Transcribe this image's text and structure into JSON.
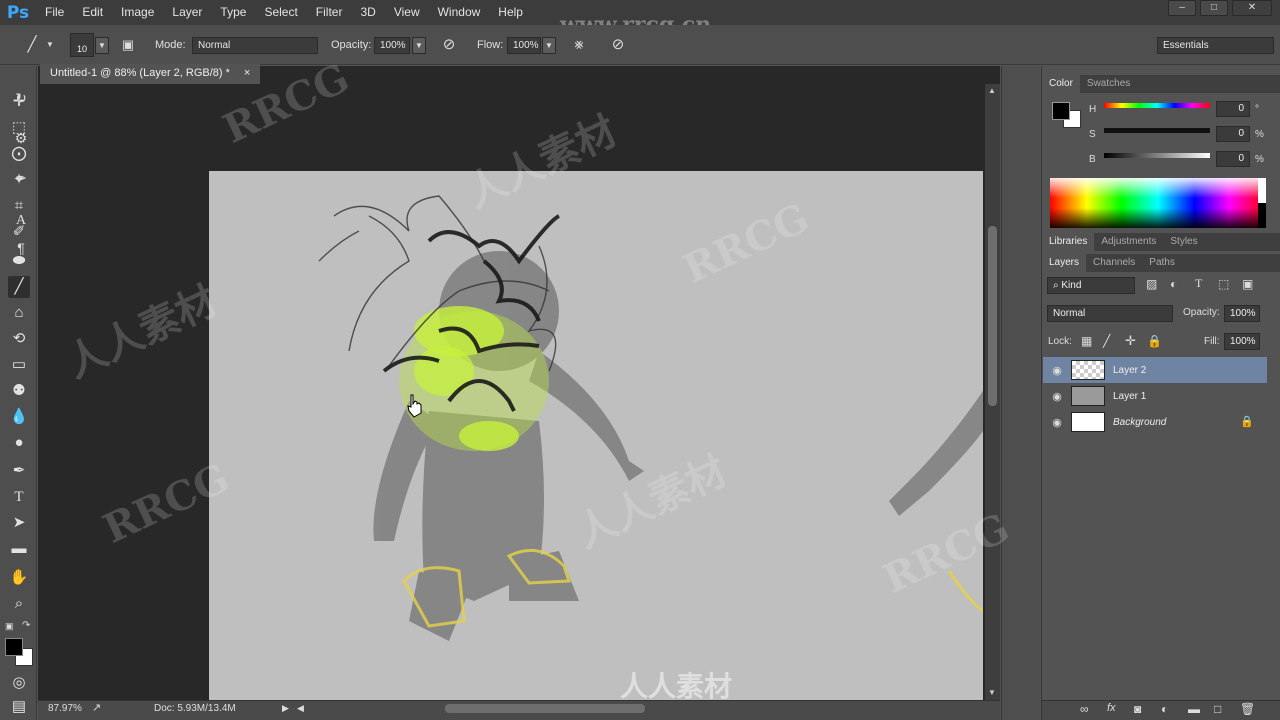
{
  "app": {
    "logo": "Ps",
    "menu": [
      "File",
      "Edit",
      "Image",
      "Layer",
      "Type",
      "Select",
      "Filter",
      "3D",
      "View",
      "Window",
      "Help"
    ],
    "window_controls": [
      "–",
      "□",
      "✕"
    ],
    "watermark_url": "www.rrcg.cn"
  },
  "options_bar": {
    "brush_size": "10",
    "mode_label": "Mode:",
    "mode_value": "Normal",
    "opacity_label": "Opacity:",
    "opacity_value": "100%",
    "flow_label": "Flow:",
    "flow_value": "100%",
    "workspace": "Essentials"
  },
  "document": {
    "tab_title": "Untitled-1 @ 88% (Layer 2, RGB/8) *",
    "tab_close": "×",
    "zoom": "87.97%",
    "doc_info": "Doc: 5.93M/13.4M"
  },
  "color_panel": {
    "tabs": [
      "Color",
      "Swatches"
    ],
    "sliders": [
      {
        "label": "H",
        "value": "0",
        "unit": "°"
      },
      {
        "label": "S",
        "value": "0",
        "unit": "%"
      },
      {
        "label": "B",
        "value": "0",
        "unit": "%"
      }
    ],
    "foreground": "#000000",
    "background": "#ffffff"
  },
  "libraries_panel": {
    "tabs": [
      "Libraries",
      "Adjustments",
      "Styles"
    ]
  },
  "layers_panel": {
    "tabs": [
      "Layers",
      "Channels",
      "Paths"
    ],
    "filter_kind": "⌕ Kind",
    "blend_mode": "Normal",
    "opacity_label": "Opacity:",
    "opacity_value": "100%",
    "lock_label": "Lock:",
    "fill_label": "Fill:",
    "fill_value": "100%",
    "layers": [
      {
        "name": "Layer 2",
        "selected": true
      },
      {
        "name": "Layer 1",
        "selected": false
      },
      {
        "name": "Background",
        "selected": false
      }
    ],
    "footer_icons": [
      "link-icon",
      "fx-icon",
      "mask-icon",
      "adjustment-icon",
      "folder-icon",
      "new-layer-icon",
      "trash-icon"
    ]
  },
  "watermarks": [
    "RRCG",
    "人人素材"
  ]
}
